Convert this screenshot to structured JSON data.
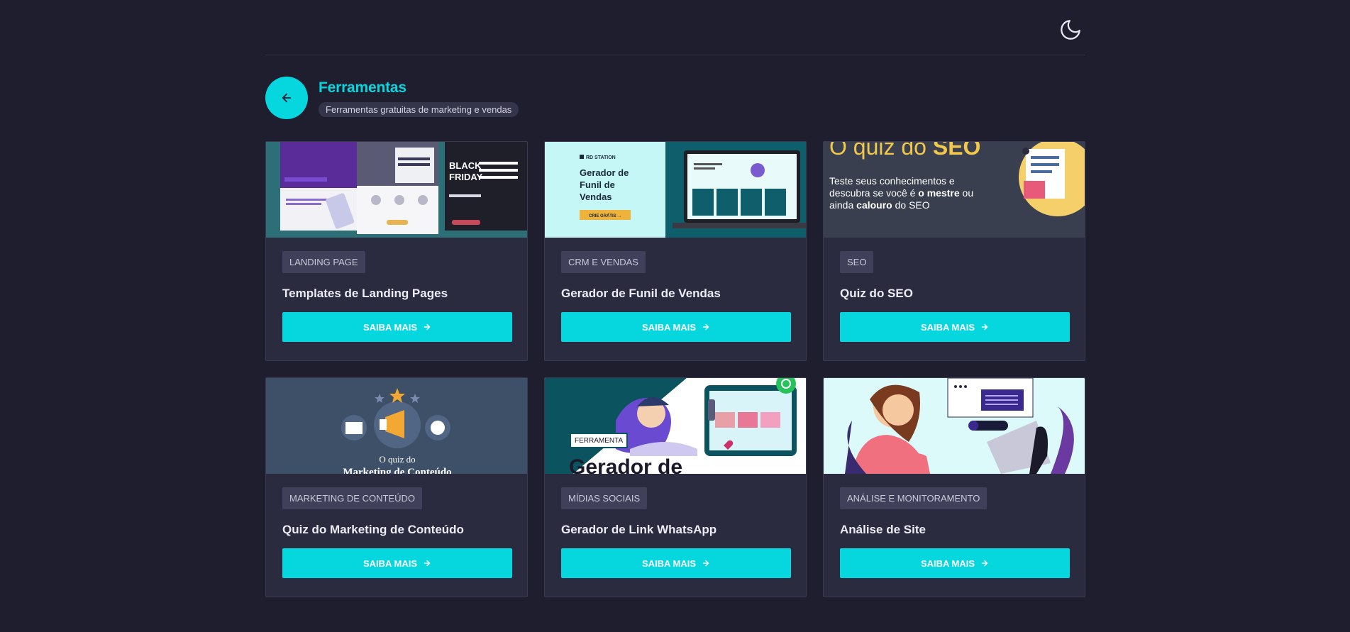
{
  "header": {
    "title": "Ferramentas",
    "subtitle": "Ferramentas gratuitas de marketing e vendas",
    "theme_icon": "moon-icon",
    "back_icon": "arrow-left-icon"
  },
  "colors": {
    "accent": "#06d6de",
    "background": "#1e1e2e",
    "card": "#2b2b40"
  },
  "cards": [
    {
      "tag": "LANDING PAGE",
      "title": "Templates de Landing Pages",
      "cta": "SAIBA MAIS",
      "thumb": {
        "black": "BLACK",
        "friday": "FRIDAY"
      }
    },
    {
      "tag": "CRM E VENDAS",
      "title": "Gerador de Funil de Vendas",
      "cta": "SAIBA MAIS",
      "thumb": {
        "brand": "RD STATION",
        "line1": "Gerador de",
        "line2": "Funil de",
        "line3": "Vendas",
        "button": "CRIE GRÁTIS →"
      }
    },
    {
      "tag": "SEO",
      "title": "Quiz do SEO",
      "cta": "SAIBA MAIS",
      "thumb": {
        "heading_a": "O quiz do ",
        "heading_b": "SEO",
        "t1": "Teste seus conhecimentos e",
        "t2": "descubra se você é ",
        "t2b": "o mestre",
        "t2c": " ou",
        "t3": "ainda ",
        "t3b": "calouro",
        "t3c": " do SEO"
      }
    },
    {
      "tag": "MARKETING DE CONTEÚDO",
      "title": "Quiz do Marketing de Conteúdo",
      "cta": "SAIBA MAIS",
      "thumb": {
        "line1": "O quiz do",
        "line2": "Marketing de Conteúdo"
      }
    },
    {
      "tag": "MÍDIAS SOCIAIS",
      "title": "Gerador de Link WhatsApp",
      "cta": "SAIBA MAIS",
      "thumb": {
        "badge": "FERRAMENTA",
        "big": "Gerador de"
      }
    },
    {
      "tag": "ANÁLISE E MONITORAMENTO",
      "title": "Análise de Site",
      "cta": "SAIBA MAIS",
      "thumb": {}
    }
  ]
}
